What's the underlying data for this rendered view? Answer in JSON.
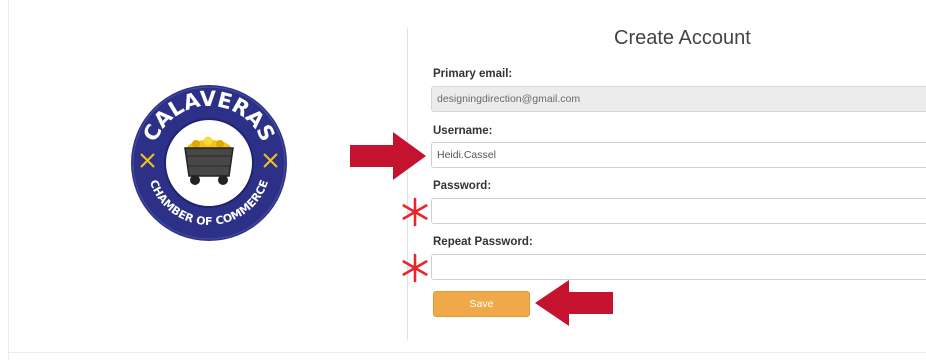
{
  "logo": {
    "top_text": "CALAVERAS",
    "bottom_text": "CHAMBER OF COMMERCE",
    "colors": {
      "ring": "#2c3187",
      "inner": "#ffffff",
      "cart": "#444444",
      "gold": "#f2c21b"
    }
  },
  "form": {
    "title": "Create Account",
    "primary_email": {
      "label": "Primary email:",
      "value": "designingdirection@gmail.com"
    },
    "username": {
      "label": "Username:",
      "value": "Heidi.Cassel"
    },
    "password": {
      "label": "Password:",
      "value": ""
    },
    "repeat_password": {
      "label": "Repeat Password:",
      "value": ""
    },
    "save_label": "Save"
  },
  "annotations": {
    "arrow_color": "#c4122f",
    "asterisk_color": "#e8242c"
  }
}
